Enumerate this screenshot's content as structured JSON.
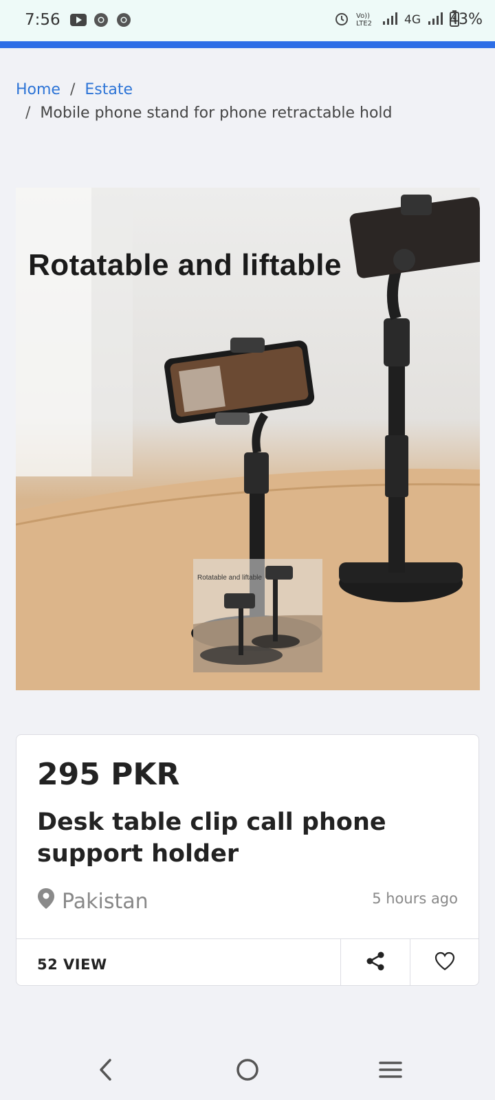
{
  "status_bar": {
    "time": "7:56",
    "network_label": "4G",
    "volte_label": "Vo)) LTE2",
    "battery_pct": "43%",
    "icons": [
      "youtube-icon",
      "chrome-icon",
      "chrome-icon",
      "alarm-icon",
      "signal-icon",
      "battery-icon"
    ]
  },
  "breadcrumb": {
    "home": "Home",
    "separator": "/",
    "category": "Estate",
    "current": "Mobile phone stand for phone retractable hold"
  },
  "product_image": {
    "caption": "Rotatable and liftable",
    "thumb_caption": "Rotatable and liftable"
  },
  "listing": {
    "price": "295 PKR",
    "title": "Desk table clip call phone support holder",
    "location": "Pakistan",
    "posted": "5 hours ago",
    "views": "52 VIEW"
  },
  "colors": {
    "accent": "#2d6ee6",
    "link": "#2d74d6",
    "muted": "#888888"
  }
}
